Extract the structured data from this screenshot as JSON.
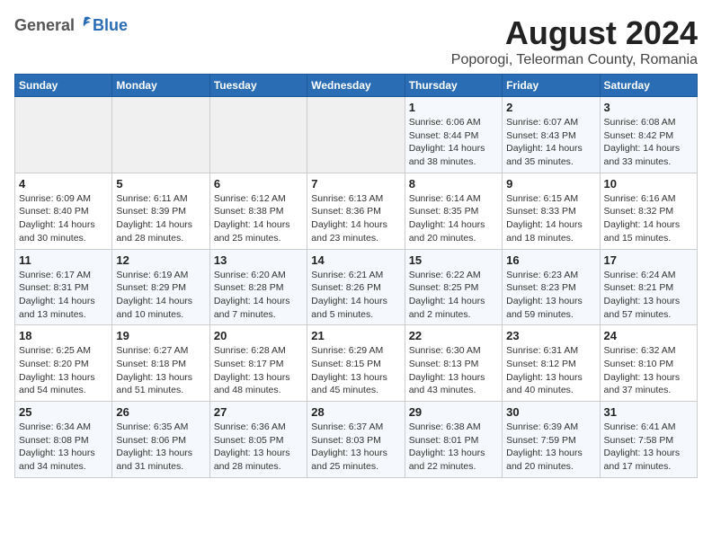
{
  "header": {
    "logo_general": "General",
    "logo_blue": "Blue",
    "title": "August 2024",
    "subtitle": "Poporogi, Teleorman County, Romania"
  },
  "weekdays": [
    "Sunday",
    "Monday",
    "Tuesday",
    "Wednesday",
    "Thursday",
    "Friday",
    "Saturday"
  ],
  "weeks": [
    [
      {
        "day": "",
        "detail": ""
      },
      {
        "day": "",
        "detail": ""
      },
      {
        "day": "",
        "detail": ""
      },
      {
        "day": "",
        "detail": ""
      },
      {
        "day": "1",
        "detail": "Sunrise: 6:06 AM\nSunset: 8:44 PM\nDaylight: 14 hours\nand 38 minutes."
      },
      {
        "day": "2",
        "detail": "Sunrise: 6:07 AM\nSunset: 8:43 PM\nDaylight: 14 hours\nand 35 minutes."
      },
      {
        "day": "3",
        "detail": "Sunrise: 6:08 AM\nSunset: 8:42 PM\nDaylight: 14 hours\nand 33 minutes."
      }
    ],
    [
      {
        "day": "4",
        "detail": "Sunrise: 6:09 AM\nSunset: 8:40 PM\nDaylight: 14 hours\nand 30 minutes."
      },
      {
        "day": "5",
        "detail": "Sunrise: 6:11 AM\nSunset: 8:39 PM\nDaylight: 14 hours\nand 28 minutes."
      },
      {
        "day": "6",
        "detail": "Sunrise: 6:12 AM\nSunset: 8:38 PM\nDaylight: 14 hours\nand 25 minutes."
      },
      {
        "day": "7",
        "detail": "Sunrise: 6:13 AM\nSunset: 8:36 PM\nDaylight: 14 hours\nand 23 minutes."
      },
      {
        "day": "8",
        "detail": "Sunrise: 6:14 AM\nSunset: 8:35 PM\nDaylight: 14 hours\nand 20 minutes."
      },
      {
        "day": "9",
        "detail": "Sunrise: 6:15 AM\nSunset: 8:33 PM\nDaylight: 14 hours\nand 18 minutes."
      },
      {
        "day": "10",
        "detail": "Sunrise: 6:16 AM\nSunset: 8:32 PM\nDaylight: 14 hours\nand 15 minutes."
      }
    ],
    [
      {
        "day": "11",
        "detail": "Sunrise: 6:17 AM\nSunset: 8:31 PM\nDaylight: 14 hours\nand 13 minutes."
      },
      {
        "day": "12",
        "detail": "Sunrise: 6:19 AM\nSunset: 8:29 PM\nDaylight: 14 hours\nand 10 minutes."
      },
      {
        "day": "13",
        "detail": "Sunrise: 6:20 AM\nSunset: 8:28 PM\nDaylight: 14 hours\nand 7 minutes."
      },
      {
        "day": "14",
        "detail": "Sunrise: 6:21 AM\nSunset: 8:26 PM\nDaylight: 14 hours\nand 5 minutes."
      },
      {
        "day": "15",
        "detail": "Sunrise: 6:22 AM\nSunset: 8:25 PM\nDaylight: 14 hours\nand 2 minutes."
      },
      {
        "day": "16",
        "detail": "Sunrise: 6:23 AM\nSunset: 8:23 PM\nDaylight: 13 hours\nand 59 minutes."
      },
      {
        "day": "17",
        "detail": "Sunrise: 6:24 AM\nSunset: 8:21 PM\nDaylight: 13 hours\nand 57 minutes."
      }
    ],
    [
      {
        "day": "18",
        "detail": "Sunrise: 6:25 AM\nSunset: 8:20 PM\nDaylight: 13 hours\nand 54 minutes."
      },
      {
        "day": "19",
        "detail": "Sunrise: 6:27 AM\nSunset: 8:18 PM\nDaylight: 13 hours\nand 51 minutes."
      },
      {
        "day": "20",
        "detail": "Sunrise: 6:28 AM\nSunset: 8:17 PM\nDaylight: 13 hours\nand 48 minutes."
      },
      {
        "day": "21",
        "detail": "Sunrise: 6:29 AM\nSunset: 8:15 PM\nDaylight: 13 hours\nand 45 minutes."
      },
      {
        "day": "22",
        "detail": "Sunrise: 6:30 AM\nSunset: 8:13 PM\nDaylight: 13 hours\nand 43 minutes."
      },
      {
        "day": "23",
        "detail": "Sunrise: 6:31 AM\nSunset: 8:12 PM\nDaylight: 13 hours\nand 40 minutes."
      },
      {
        "day": "24",
        "detail": "Sunrise: 6:32 AM\nSunset: 8:10 PM\nDaylight: 13 hours\nand 37 minutes."
      }
    ],
    [
      {
        "day": "25",
        "detail": "Sunrise: 6:34 AM\nSunset: 8:08 PM\nDaylight: 13 hours\nand 34 minutes."
      },
      {
        "day": "26",
        "detail": "Sunrise: 6:35 AM\nSunset: 8:06 PM\nDaylight: 13 hours\nand 31 minutes."
      },
      {
        "day": "27",
        "detail": "Sunrise: 6:36 AM\nSunset: 8:05 PM\nDaylight: 13 hours\nand 28 minutes."
      },
      {
        "day": "28",
        "detail": "Sunrise: 6:37 AM\nSunset: 8:03 PM\nDaylight: 13 hours\nand 25 minutes."
      },
      {
        "day": "29",
        "detail": "Sunrise: 6:38 AM\nSunset: 8:01 PM\nDaylight: 13 hours\nand 22 minutes."
      },
      {
        "day": "30",
        "detail": "Sunrise: 6:39 AM\nSunset: 7:59 PM\nDaylight: 13 hours\nand 20 minutes."
      },
      {
        "day": "31",
        "detail": "Sunrise: 6:41 AM\nSunset: 7:58 PM\nDaylight: 13 hours\nand 17 minutes."
      }
    ]
  ]
}
